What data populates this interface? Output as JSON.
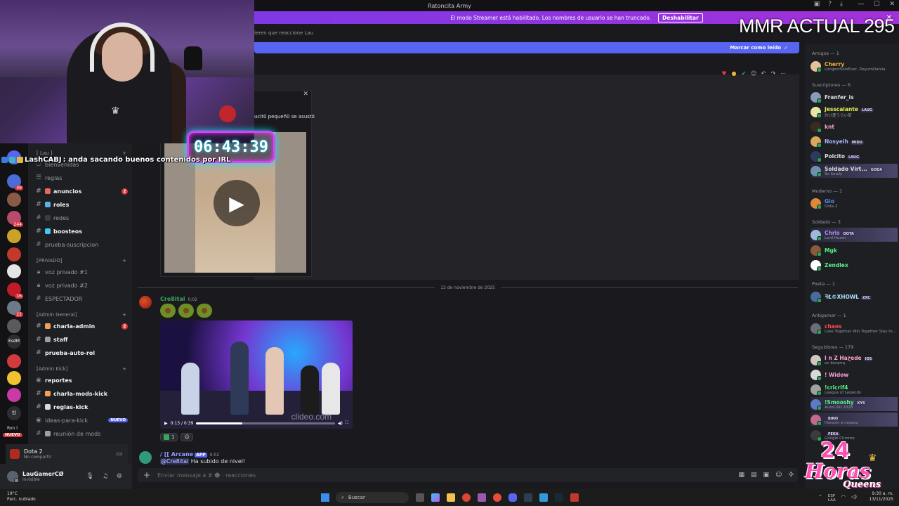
{
  "window": {
    "title": "Ratoncita Army"
  },
  "banner": {
    "text": "El modo Streamer está habilitado. Los nombres de usuario se han truncado.",
    "button": "Deshabilitar"
  },
  "overlay": {
    "mmr": "MMR ACTUAL 295",
    "timer": "06:43:39",
    "chat_user": "LashCABJ",
    "chat_text": ": anda sacando buenos contenidos por IRL"
  },
  "thread_bar": {
    "text": "ieren que reaccione Lau"
  },
  "new_messages": {
    "label": "Marcar como leído"
  },
  "popup": {
    "caption": "ucit0 pequeñ0 se asustó"
  },
  "date_divider": "13 de noviembre de 2025",
  "messages": [
    {
      "author": "Cre8ital",
      "time": "0:02",
      "author_color": "#3ba55c"
    },
    {
      "author": "/ [[ Arcane",
      "app_tag": "APP",
      "time": "0:02",
      "mention": "@Cre8ital",
      "text": "Ha subido de nivel!",
      "author_color": "#8e9cff"
    }
  ],
  "video": {
    "time": "0:13 / 0:39",
    "progress": 0.33,
    "watermark": "clideo.com"
  },
  "reactions": [
    {
      "count": "1"
    }
  ],
  "composer": {
    "placeholder": "Enviar mensaje a #",
    "suffix": "reacciones"
  },
  "server_rail": {
    "badges": [
      "49",
      "244",
      "16",
      "22"
    ],
    "label_esdm": "EsdM",
    "label_tl": "tl",
    "label_ron": "Ron l",
    "new_badge": "NUEVO"
  },
  "channels": {
    "cat_lau": "[ Lau ]",
    "items_top": [
      {
        "name": "bienvenidas",
        "bold": false
      },
      {
        "name": "reglas",
        "bold": false
      },
      {
        "name": "anuncios",
        "bold": true,
        "count": "2"
      },
      {
        "name": "roles",
        "bold": true
      },
      {
        "name": "redes",
        "bold": false
      },
      {
        "name": "boosteos",
        "bold": true
      },
      {
        "name": "prueba-suscripcion",
        "bold": false
      }
    ],
    "cat_privado": "[PRIVADO]",
    "privado": [
      "voz privado #1",
      "voz privado #2",
      "ESPECTADOR"
    ],
    "cat_admin_general": "[Admin General]",
    "admin_general": [
      {
        "name": "charla-admin",
        "bold": true,
        "count": "2"
      },
      {
        "name": "staff",
        "bold": true
      },
      {
        "name": "prueba-auto-rol",
        "bold": true
      }
    ],
    "cat_admin_kick": "[Admin Kick]",
    "admin_kick": [
      {
        "name": "reportes",
        "bold": true
      },
      {
        "name": "charla-mods-kick",
        "bold": true
      },
      {
        "name": "reglas-kick",
        "bold": true
      },
      {
        "name": "ideas-para-kick",
        "bold": false,
        "new": "NUEVO"
      },
      {
        "name": "reunión de mods",
        "bold": false
      }
    ]
  },
  "voice": {
    "title": "Dota 2",
    "subtitle": "No compartir"
  },
  "user": {
    "name": "LauGamerCØ",
    "status": "Invisible"
  },
  "members": {
    "groups": [
      "Amigos — 1",
      "Suscriptores — 6",
      "Moderno — 1",
      "Soldado — 3",
      "Poeta — 1",
      "Antigamer — 1",
      "Seguidores — 179"
    ],
    "list": [
      {
        "name": "Cherry",
        "sub": "LongestSoloEver, DayumDahlia",
        "color": "#f0b232"
      },
      {
        "name": "Franfer_is",
        "sub": "",
        "color": "#dbdee1"
      },
      {
        "name": "Jesscalante",
        "sub": "灼け愛うらい草",
        "color": "#e4f04e",
        "tag": "LAUG"
      },
      {
        "name": "knt",
        "sub": "",
        "color": "#f2a6c7"
      },
      {
        "name": "Nosyeih",
        "sub": "",
        "color": "#a6b4ff",
        "tag": "MIDU"
      },
      {
        "name": "Polcito",
        "sub": "",
        "color": "#dbdee1",
        "tag": "LAUG"
      },
      {
        "name": "Soldado Virt...",
        "sub": "So lonely",
        "color": "#dbdee1",
        "tag": "GODA"
      },
      {
        "name": "Gio",
        "sub": "Dota 2",
        "color": "#4d8cff"
      },
      {
        "name": "Chris",
        "sub": "Lord Huron",
        "color": "#b58bff",
        "tag": "DOTA"
      },
      {
        "name": "Mgk",
        "sub": "",
        "color": "#57f287"
      },
      {
        "name": "Zendlex",
        "sub": "",
        "color": "#57f287"
      },
      {
        "name": "ꟻŁ©XHOWL",
        "sub": "",
        "color": "#a6e3ff",
        "tag": "ZXC"
      },
      {
        "name": "chaos",
        "sub": "Lose Together Win Together Slay to...",
        "color": "#ff4d4d"
      },
      {
        "name": "I n Z Haɀede",
        "sub": "ov bivqmq",
        "color": "#ff9ed2",
        "tag": "IOS"
      },
      {
        "name": "! Widow",
        "sub": "",
        "color": "#ff9ed2"
      },
      {
        "name": "!cricrif4",
        "sub": "League of Legends",
        "color": "#57f287"
      },
      {
        "name": "!Smooshy",
        "sub": "AutoCAD 2026",
        "color": "#57f287",
        "tag": "KYS"
      },
      {
        "name": "",
        "sub": "Hanami e nosecu",
        "color": "#ff9ed2",
        "tag": "BINO"
      },
      {
        "name": "",
        "sub": "Google Chrome",
        "color": "#ff9ed2",
        "tag": "FEKA"
      }
    ]
  },
  "streamer_logo": {
    "line1": "24",
    "line2": "Horas",
    "line3": "Queens"
  },
  "taskbar": {
    "weather_temp": "19°C",
    "weather_desc": "Parc. nublado",
    "search": "Buscar",
    "lang": "ESP",
    "lang2": "LAA",
    "time": "9:30 a. m.",
    "date": "13/11/2025"
  }
}
